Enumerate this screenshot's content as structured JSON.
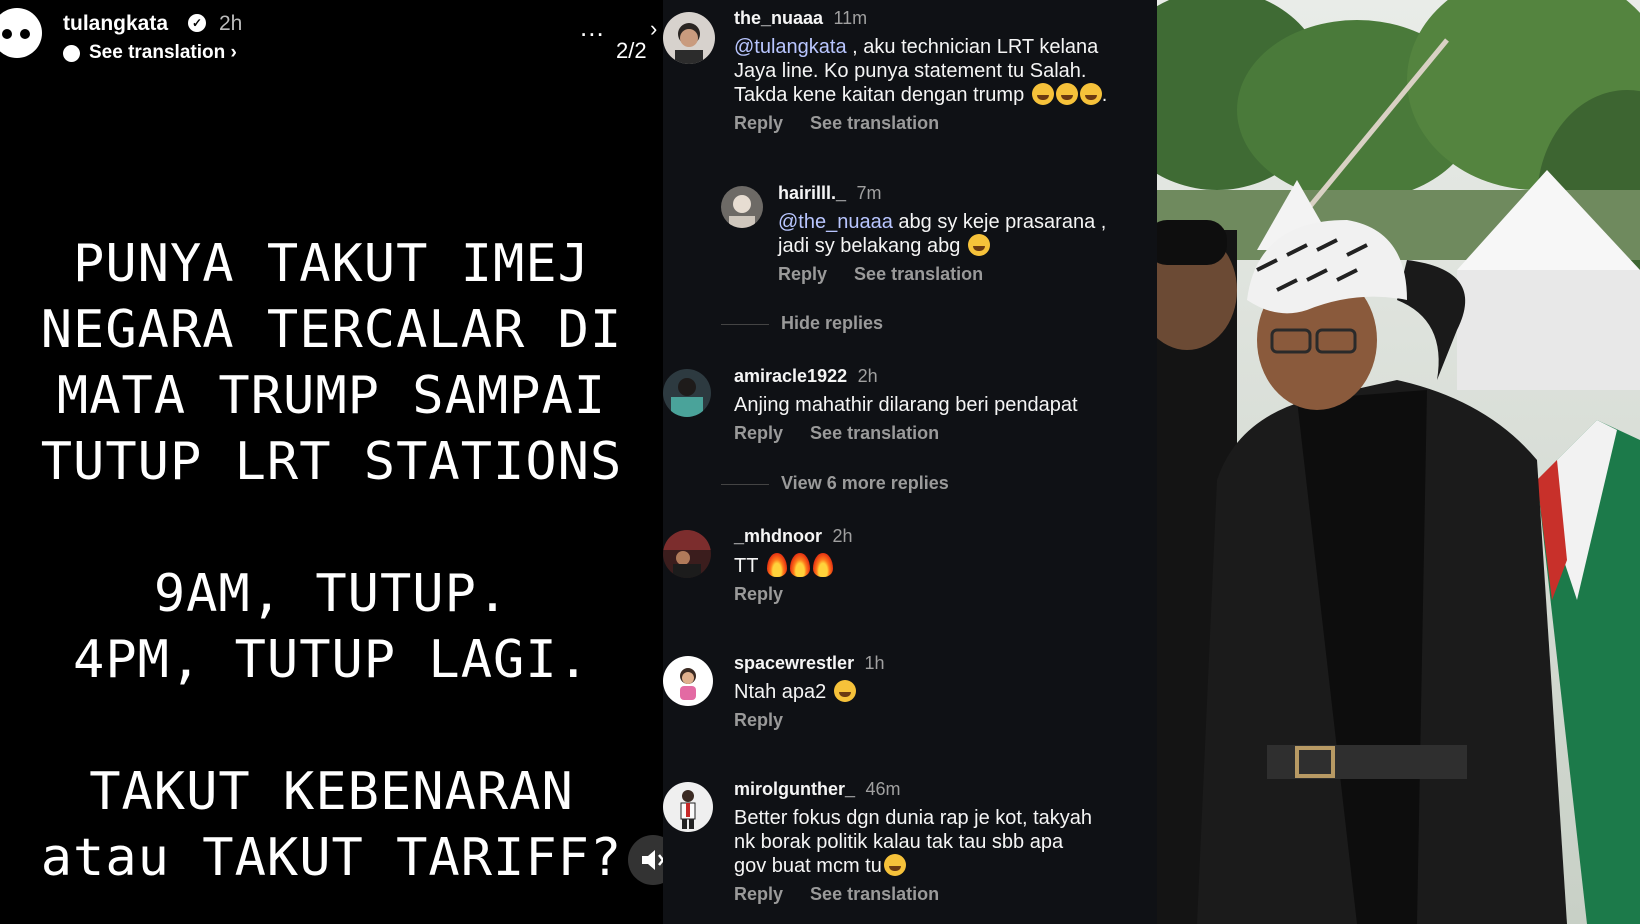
{
  "story": {
    "username": "tulangkata",
    "time": "2h",
    "see_translation": "See translation ›",
    "page_indicator": "2/2",
    "more_label": "...",
    "lines": [
      "PUNYA TAKUT IMEJ",
      "NEGARA TERCALAR DI",
      "MATA TRUMP SAMPAI",
      "TUTUP LRT STATIONS",
      "",
      "9AM, TUTUP.",
      "4PM, TUTUP LAGI.",
      "",
      "TAKUT KEBENARAN",
      "atau TAKUT TARIFF?"
    ]
  },
  "comments": {
    "reply_label": "Reply",
    "translation_label": "See translation",
    "hide_replies": "Hide replies",
    "view_more_replies": "View 6 more replies",
    "items": [
      {
        "user": "the_nuaaa",
        "time": "11m",
        "mention": "@tulangkata",
        "text_lines": [
          ", aku technician LRT kelana",
          "Jaya line. Ko punya statement tu Salah.",
          "Takda kene kaitan dengan trump"
        ]
      },
      {
        "user": "hairilll._",
        "time": "7m",
        "mention": "@the_nuaaa",
        "text_lines": [
          "abg sy keje prasarana ,",
          "jadi sy belakang abg"
        ]
      },
      {
        "user": "amiracle1922",
        "time": "2h",
        "text_lines": [
          "Anjing mahathir dilarang beri pendapat"
        ]
      },
      {
        "user": "_mhdnoor",
        "time": "2h",
        "text_lines": [
          "TT"
        ]
      },
      {
        "user": "spacewrestler",
        "time": "1h",
        "text_lines": [
          "Ntah apa2"
        ]
      },
      {
        "user": "mirolgunther_",
        "time": "46m",
        "text_lines": [
          "Better fokus dgn dunia rap je kot, takyah",
          "nk borak politik kalau tak tau sbb apa",
          "gov buat mcm tu"
        ]
      }
    ]
  },
  "icons": {
    "verified": "verified-badge-icon",
    "mute": "muted-speaker-icon",
    "more": "more-options-icon",
    "next": "chevron-right-icon"
  },
  "colors": {
    "story_bg": "#000000",
    "comments_bg": "#0f1115",
    "mention": "#b9c6ff",
    "muted_text": "#9a9a9a"
  }
}
